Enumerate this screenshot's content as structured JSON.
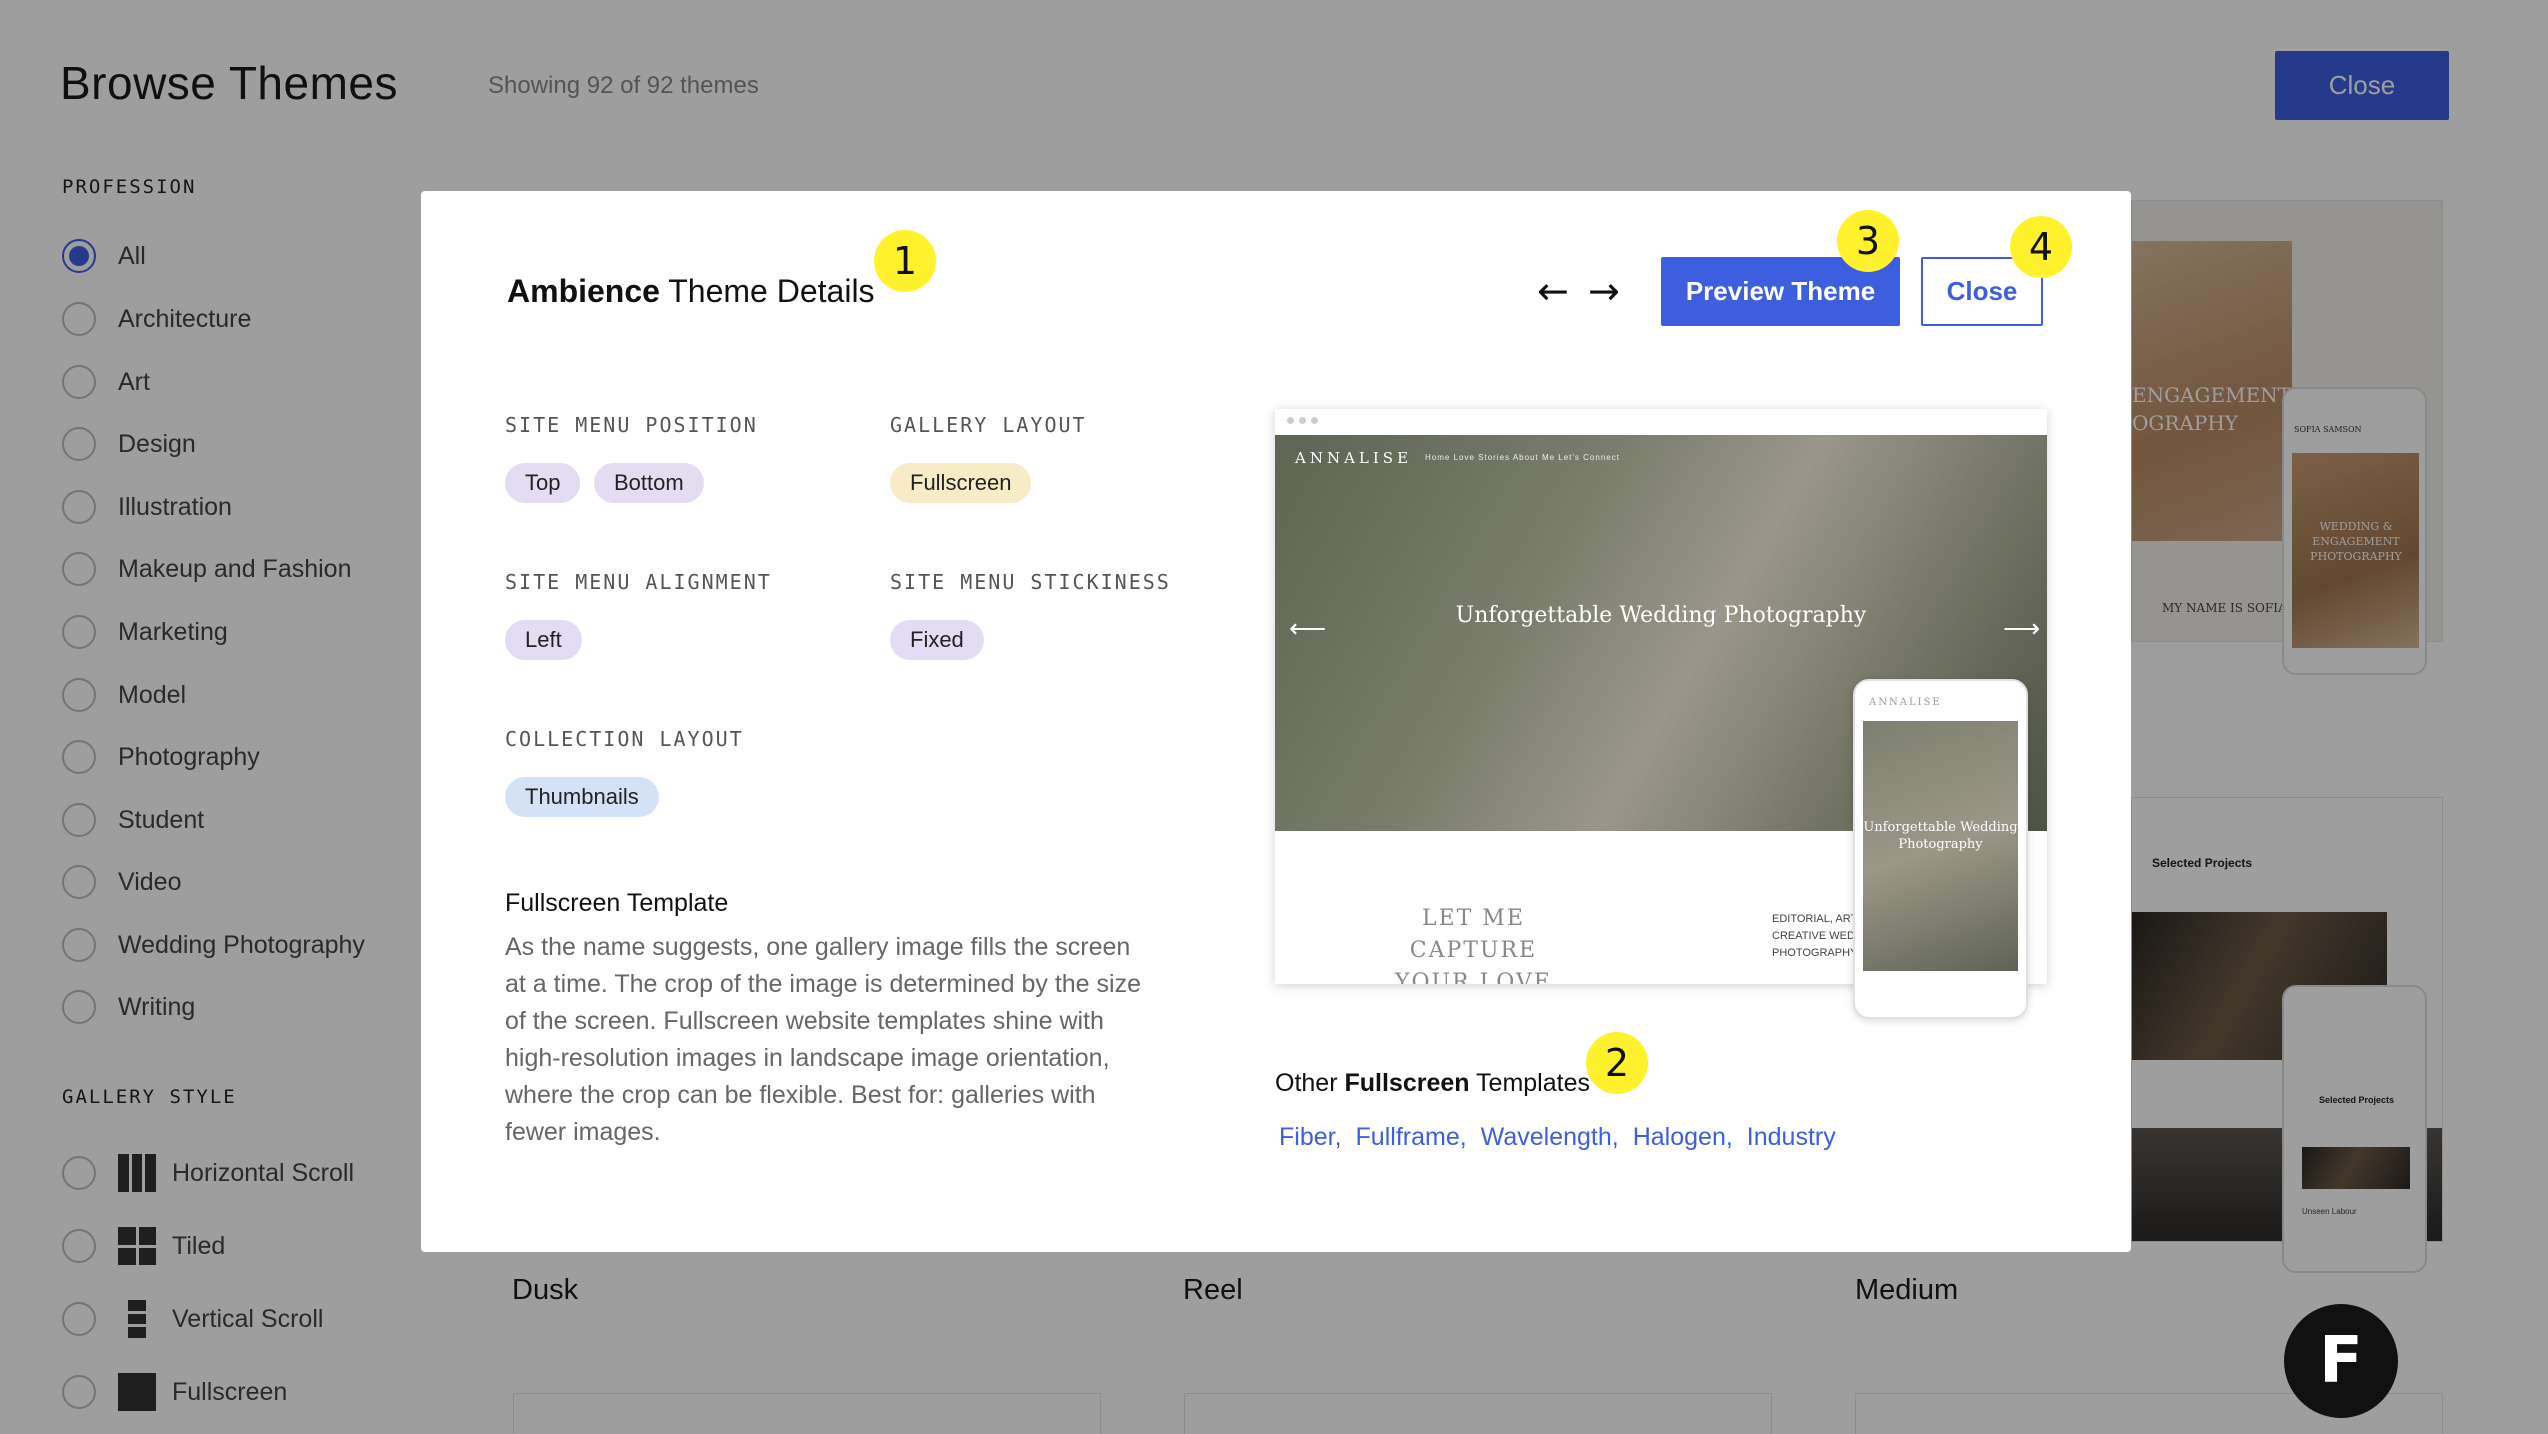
{
  "page": {
    "title": "Browse Themes",
    "count": "Showing 92 of 92 themes",
    "close_label": "Close"
  },
  "sidebar": {
    "profession_heading": "PROFESSION",
    "professions": [
      {
        "label": "All",
        "selected": true
      },
      {
        "label": "Architecture"
      },
      {
        "label": "Art"
      },
      {
        "label": "Design"
      },
      {
        "label": "Illustration"
      },
      {
        "label": "Makeup and Fashion"
      },
      {
        "label": "Marketing"
      },
      {
        "label": "Model"
      },
      {
        "label": "Photography"
      },
      {
        "label": "Student"
      },
      {
        "label": "Video"
      },
      {
        "label": "Wedding Photography"
      },
      {
        "label": "Writing"
      }
    ],
    "gallery_style_heading": "GALLERY STYLE",
    "gallery_styles": [
      {
        "label": "Horizontal Scroll",
        "icon": "horizontal-scroll-icon"
      },
      {
        "label": "Tiled",
        "icon": "tiled-icon"
      },
      {
        "label": "Vertical Scroll",
        "icon": "vertical-scroll-icon"
      },
      {
        "label": "Fullscreen",
        "icon": "fullscreen-icon"
      }
    ]
  },
  "grid": {
    "labels": [
      "Dusk",
      "Reel",
      "Medium"
    ],
    "card_top_right": {
      "headline": "ENGAGEMENT\nOGRAPHY",
      "caption": "MY NAME IS SOFIA",
      "phone_brand": "SOFIA SAMSON",
      "phone_text": "WEDDING & ENGAGEMENT PHOTOGRAPHY"
    },
    "card_bottom_right": {
      "title": "Selected Projects",
      "phone_title": "Selected Projects",
      "phone_caption": "Unseen Labour"
    }
  },
  "modal": {
    "theme_name": "Ambience",
    "title_suffix": "Theme Details",
    "preview_label": "Preview Theme",
    "close_label": "Close",
    "prev_arrow": "←",
    "next_arrow": "→",
    "attributes": {
      "site_menu_position": {
        "label": "SITE MENU POSITION",
        "values": [
          "Top",
          "Bottom"
        ]
      },
      "gallery_layout": {
        "label": "GALLERY LAYOUT",
        "values": [
          "Fullscreen"
        ]
      },
      "site_menu_alignment": {
        "label": "SITE MENU ALIGNMENT",
        "values": [
          "Left"
        ]
      },
      "site_menu_stickiness": {
        "label": "SITE MENU STICKINESS",
        "values": [
          "Fixed"
        ]
      },
      "collection_layout": {
        "label": "COLLECTION LAYOUT",
        "values": [
          "Thumbnails"
        ]
      }
    },
    "template_heading": "Fullscreen Template",
    "template_description": "As the name suggests, one gallery image fills the screen at a time. The crop of the image is determined by the size of the screen. Fullscreen website templates shine with high-resolution images in landscape image orientation, where the crop can be flexible. Best for: galleries with fewer images.",
    "preview": {
      "brand": "ANNALISE",
      "nav": "Home   Love Stories   About Me   Let's Connect",
      "headline": "Unforgettable Wedding Photography",
      "lower_left": "LET ME\nCAPTURE\nYOUR LOVE",
      "lower_right": "EDITORIAL, ART\nCREATIVE WED\nPHOTOGRAPHY",
      "phone_brand": "ANNALISE",
      "phone_text": "Unforgettable Wedding Photography"
    },
    "other_prefix": "Other",
    "other_category": "Fullscreen",
    "other_suffix": "Templates",
    "other_links": [
      "Fiber,",
      "Fullframe,",
      "Wavelength,",
      "Halogen,",
      "Industry"
    ]
  },
  "badges": [
    "1",
    "2",
    "3",
    "4"
  ],
  "fab_label": "F",
  "colors": {
    "accent": "#3e5ee0",
    "badge": "#fff12b",
    "pill_lilac": "#e3dcf3",
    "pill_cream": "#f7ecc5",
    "pill_blue": "#d4e2f7"
  }
}
